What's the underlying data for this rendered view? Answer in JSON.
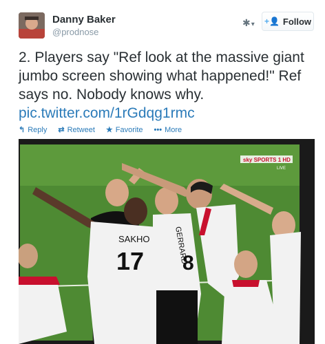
{
  "user": {
    "display_name": "Danny Baker",
    "handle": "@prodnose"
  },
  "follow_button": {
    "label": "Follow"
  },
  "tweet": {
    "text": "2. Players say \"Ref look at the massive giant jumbo screen showing what happened!\" Ref says no. Nobody knows why.",
    "link": "pic.twitter.com/1rGdqg1rmc"
  },
  "actions": [
    {
      "label": "Reply",
      "icon": "reply-icon"
    },
    {
      "label": "Retweet",
      "icon": "retweet-icon"
    },
    {
      "label": "Favorite",
      "icon": "star-icon"
    },
    {
      "label": "More",
      "icon": "more-icon"
    }
  ],
  "media": {
    "broadcaster": "sky SPORTS 1 HD",
    "live": "LIVE",
    "player_names": [
      "SAKHO",
      "GERRARD"
    ],
    "player_numbers": [
      "17",
      "8"
    ]
  },
  "colors": {
    "link": "#2b7bb9",
    "pitch": "#4e8a33",
    "shirt": "#f2f2f2",
    "trim": "#c8102e"
  }
}
